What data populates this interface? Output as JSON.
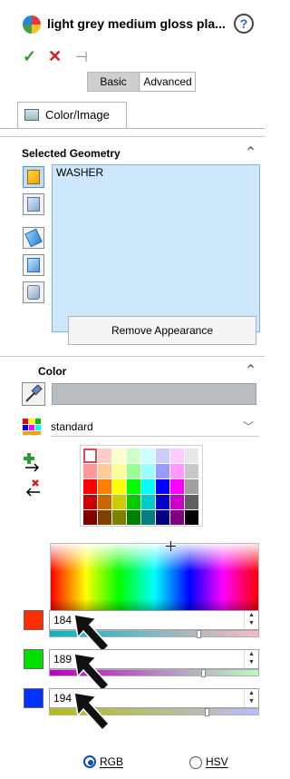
{
  "header": {
    "title": "light grey medium gloss pla...",
    "help_glyph": "?",
    "ok_glyph": "✓",
    "cancel_glyph": "✕",
    "pin_glyph": "⊣"
  },
  "mode_tabs": [
    {
      "label": "Basic",
      "active": true
    },
    {
      "label": "Advanced",
      "active": false
    }
  ],
  "panel_tab": {
    "label": "Color/Image"
  },
  "selected_geometry": {
    "title": "Selected Geometry",
    "items": [
      "WASHER"
    ],
    "filter_icons": [
      "part-filter-icon",
      "face-filter-icon",
      "feature-filter-icon",
      "body-filter-icon",
      "component-filter-icon"
    ]
  },
  "remove_button": {
    "label": "Remove Appearance"
  },
  "color": {
    "title": "Color",
    "current_color": "#b8bdc2",
    "swatch_set": "standard",
    "swatch_actions": [
      "add-swatch-icon",
      "remove-swatch-icon"
    ],
    "palette_rows": [
      [
        "#ffffff",
        "#ffcccc",
        "#ffffcc",
        "#ccffcc",
        "#ccffff",
        "#ccccff",
        "#ffccff",
        "#e8e8e8"
      ],
      [
        "#ff9999",
        "#ffcc99",
        "#ffff99",
        "#99ff99",
        "#99ffff",
        "#9999ff",
        "#ff99ff",
        "#c8c8c8"
      ],
      [
        "#ff0000",
        "#ff8000",
        "#ffff00",
        "#00ff00",
        "#00ffff",
        "#0000ff",
        "#ff00ff",
        "#a0a0a0"
      ],
      [
        "#cc0000",
        "#cc6600",
        "#cccc00",
        "#00cc00",
        "#00cccc",
        "#0000cc",
        "#cc00cc",
        "#606060"
      ],
      [
        "#800000",
        "#804000",
        "#808000",
        "#008000",
        "#008080",
        "#000080",
        "#800080",
        "#000000"
      ]
    ],
    "selected_palette_cell": [
      0,
      0
    ],
    "channels": [
      {
        "name": "red",
        "swatch": "#ff2d00",
        "value": "184",
        "level": 184,
        "grad_from": "#00b8c2",
        "grad_to": "#ffb8c2"
      },
      {
        "name": "green",
        "swatch": "#00e000",
        "value": "189",
        "level": 189,
        "grad_from": "#b800c2",
        "grad_to": "#b8ffc2"
      },
      {
        "name": "blue",
        "swatch": "#0033ff",
        "value": "194",
        "level": 194,
        "grad_from": "#b8bd00",
        "grad_to": "#b8bdff"
      }
    ],
    "modes": [
      {
        "label": "RGB",
        "selected": true
      },
      {
        "label": "HSV",
        "selected": false
      }
    ]
  }
}
